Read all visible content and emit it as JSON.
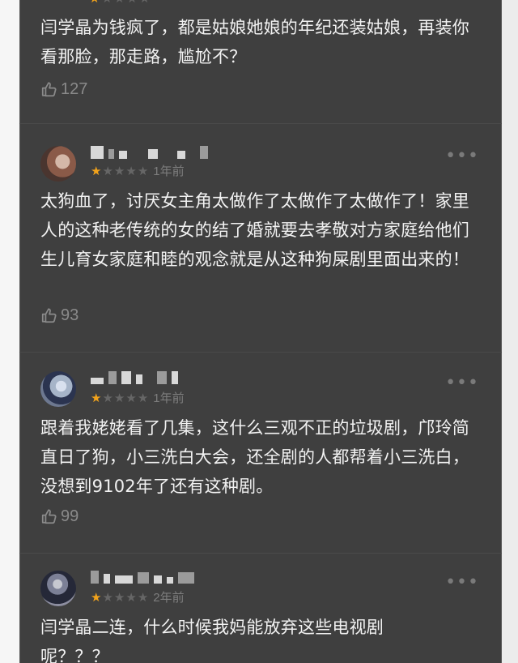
{
  "colors": {
    "panel_background": "#3f3f3f",
    "text": "#f2f2f2",
    "muted": "#8a8a8a",
    "star_active": "#f2a31b"
  },
  "icons": {
    "like": "thumbs-up-icon",
    "more": "more-icon",
    "star": "star-icon"
  },
  "reviews": [
    {
      "content": "闫学晶为钱疯了，都是姑娘她娘的年纪还装姑娘，再装你看那脸，那走路，尴尬不？",
      "likes": "127"
    },
    {
      "rating": 1,
      "time": "1年前",
      "content": "太狗血了，讨厌女主角太做作了太做作了太做作了！家里人的这种老传统的女的结了婚就要去孝敬对方家庭给他们生儿育女家庭和睦的观念就是从这种狗屎剧里面出来的！",
      "likes": "93"
    },
    {
      "rating": 1,
      "time": "1年前",
      "content": "跟着我姥姥看了几集，这什么三观不正的垃圾剧，邝玲简直日了狗，小三洗白大会，还全剧的人都帮着小三洗白，没想到9102年了还有这种剧。",
      "likes": "99"
    },
    {
      "rating": 1,
      "time": "2年前",
      "content": "闫学晶二连，什么时候我妈能放弃这些电视剧呢？？？"
    }
  ]
}
